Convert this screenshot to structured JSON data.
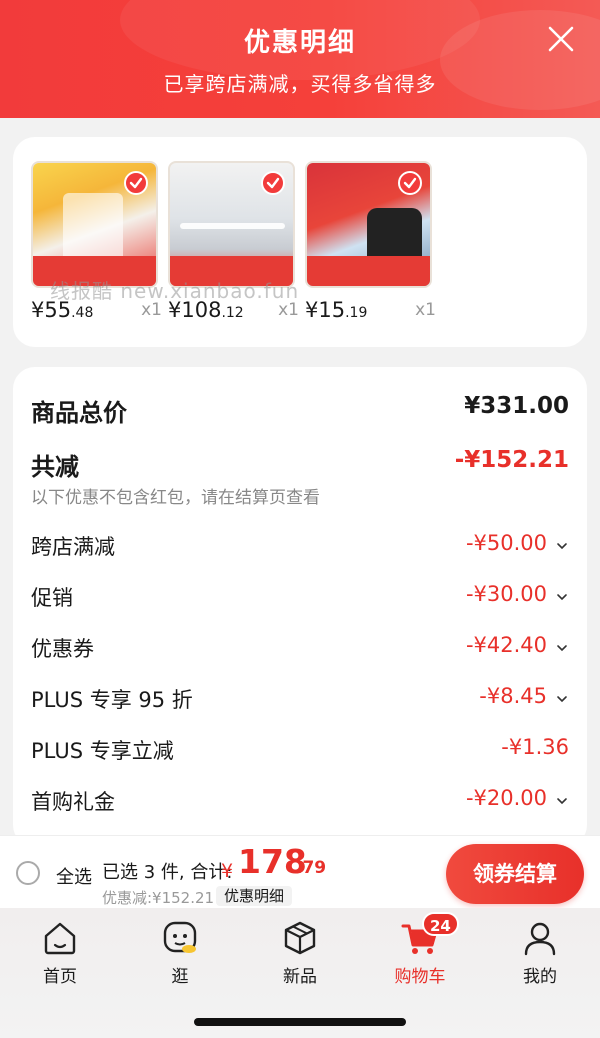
{
  "header": {
    "title": "优惠明细",
    "subtitle": "已享跨店满减，买得多省得多"
  },
  "products": [
    {
      "price_int": "¥55",
      "price_dec": ".48",
      "qty": "x1"
    },
    {
      "price_int": "¥108",
      "price_dec": ".12",
      "qty": "x1"
    },
    {
      "price_int": "¥15",
      "price_dec": ".19",
      "qty": "x1"
    }
  ],
  "watermark": "线报酷 new.xianbao.fun",
  "summary": {
    "total_label": "商品总价",
    "total_value": "¥331.00",
    "reduce_label": "共减",
    "reduce_value": "-¥152.21",
    "note": "以下优惠不包含红包，请在结算页查看",
    "items": [
      {
        "label": "跨店满减",
        "value": "-¥50.00"
      },
      {
        "label": "促销",
        "value": "-¥30.00"
      },
      {
        "label": "优惠券",
        "value": "-¥42.40"
      },
      {
        "label": "PLUS 专享 95 折",
        "value": "-¥8.45"
      },
      {
        "label": "PLUS 专享立减",
        "value": "-¥1.36"
      },
      {
        "label": "首购礼金",
        "value": "-¥20.00"
      }
    ]
  },
  "checkout": {
    "select_all": "全选",
    "selected_info": "已选 3 件, 合计:",
    "sum_yen": "¥",
    "sum_int": "178",
    "sum_dec": ".79",
    "discount_line": "优惠减:¥152.21",
    "detail_tag": "优惠明细",
    "button": "领券结算"
  },
  "tabs": [
    {
      "label": "首页",
      "icon": "home-icon"
    },
    {
      "label": "逛",
      "icon": "browse-mascot-icon"
    },
    {
      "label": "新品",
      "icon": "cube-icon"
    },
    {
      "label": "购物车",
      "icon": "cart-icon",
      "badge": "24",
      "active": true
    },
    {
      "label": "我的",
      "icon": "user-icon"
    }
  ],
  "colors": {
    "accent": "#e8302a",
    "header": "#f23b3b"
  }
}
